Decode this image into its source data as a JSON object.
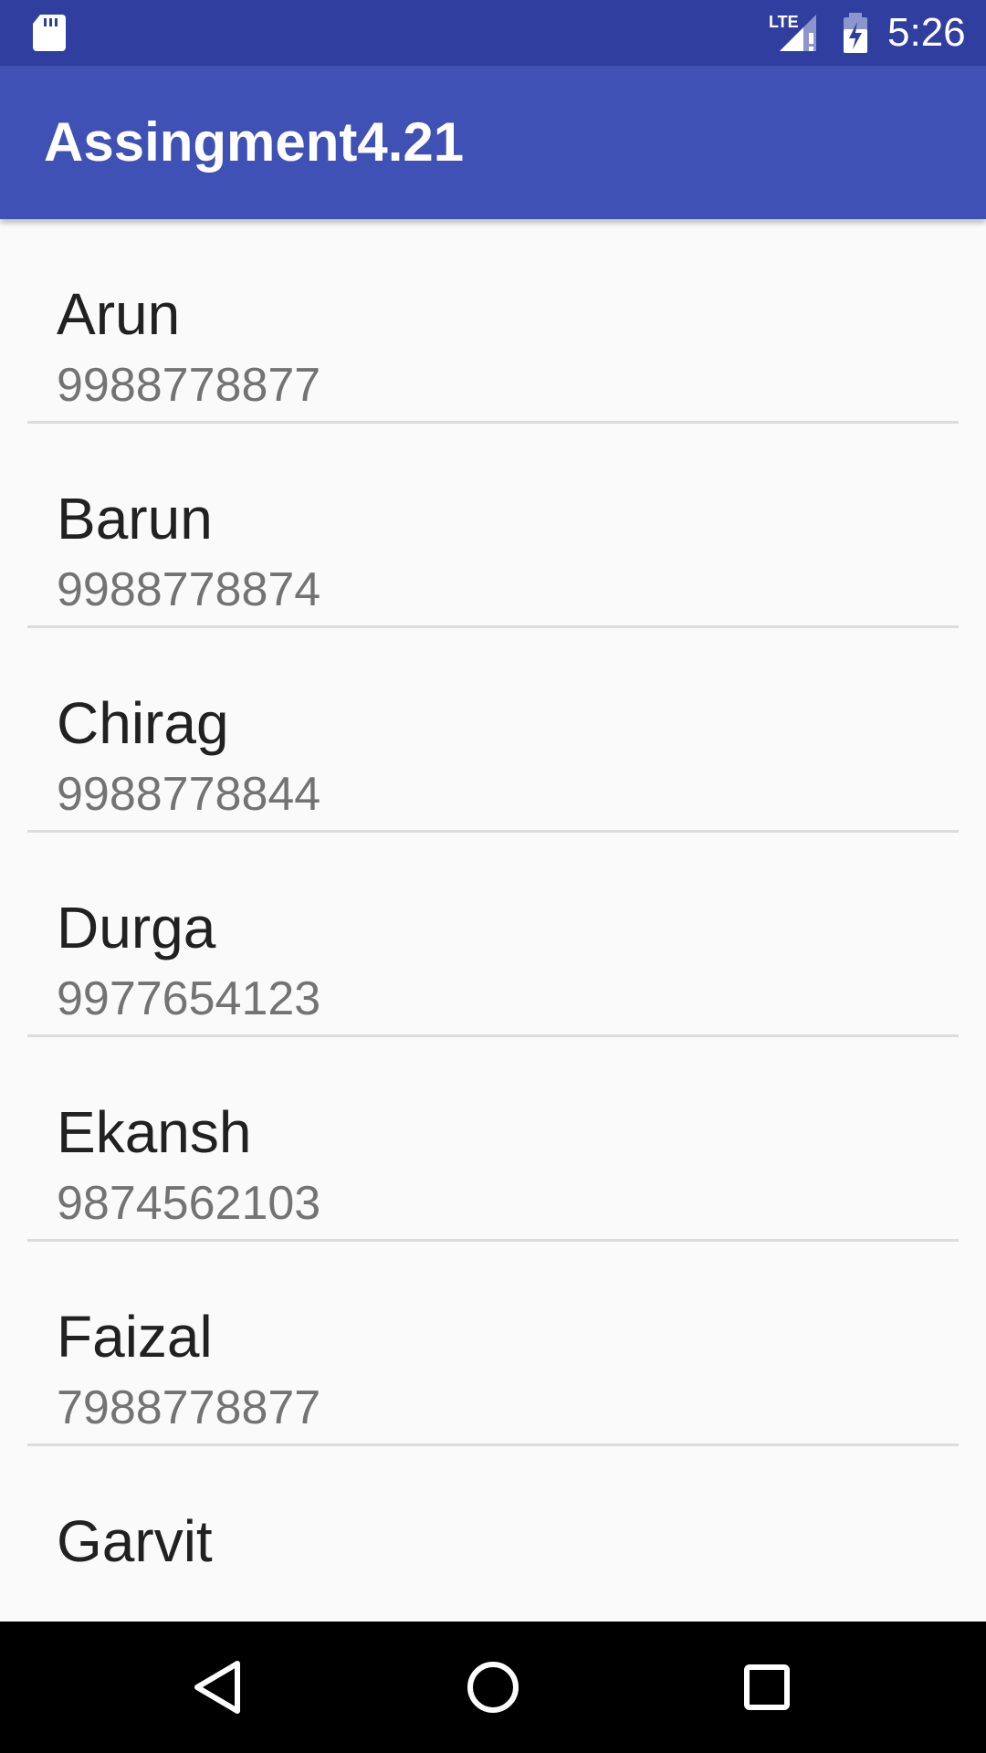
{
  "status_bar": {
    "time": "5:26",
    "network_label": "LTE",
    "icons": [
      "sd-card-icon",
      "lte-signal-icon",
      "battery-charging-icon"
    ]
  },
  "app_bar": {
    "title": "Assingment4.21",
    "color": "#3f51b5",
    "status_color": "#303f9f"
  },
  "contacts": [
    {
      "name": "Arun",
      "phone": "9988778877"
    },
    {
      "name": "Barun",
      "phone": "9988778874"
    },
    {
      "name": "Chirag",
      "phone": "9988778844"
    },
    {
      "name": "Durga",
      "phone": "9977654123"
    },
    {
      "name": "Ekansh",
      "phone": "9874562103"
    },
    {
      "name": "Faizal",
      "phone": "7988778877"
    },
    {
      "name": "Garvit",
      "phone": ""
    }
  ],
  "nav_bar": {
    "icons": [
      "back-icon",
      "home-icon",
      "recents-icon"
    ]
  }
}
